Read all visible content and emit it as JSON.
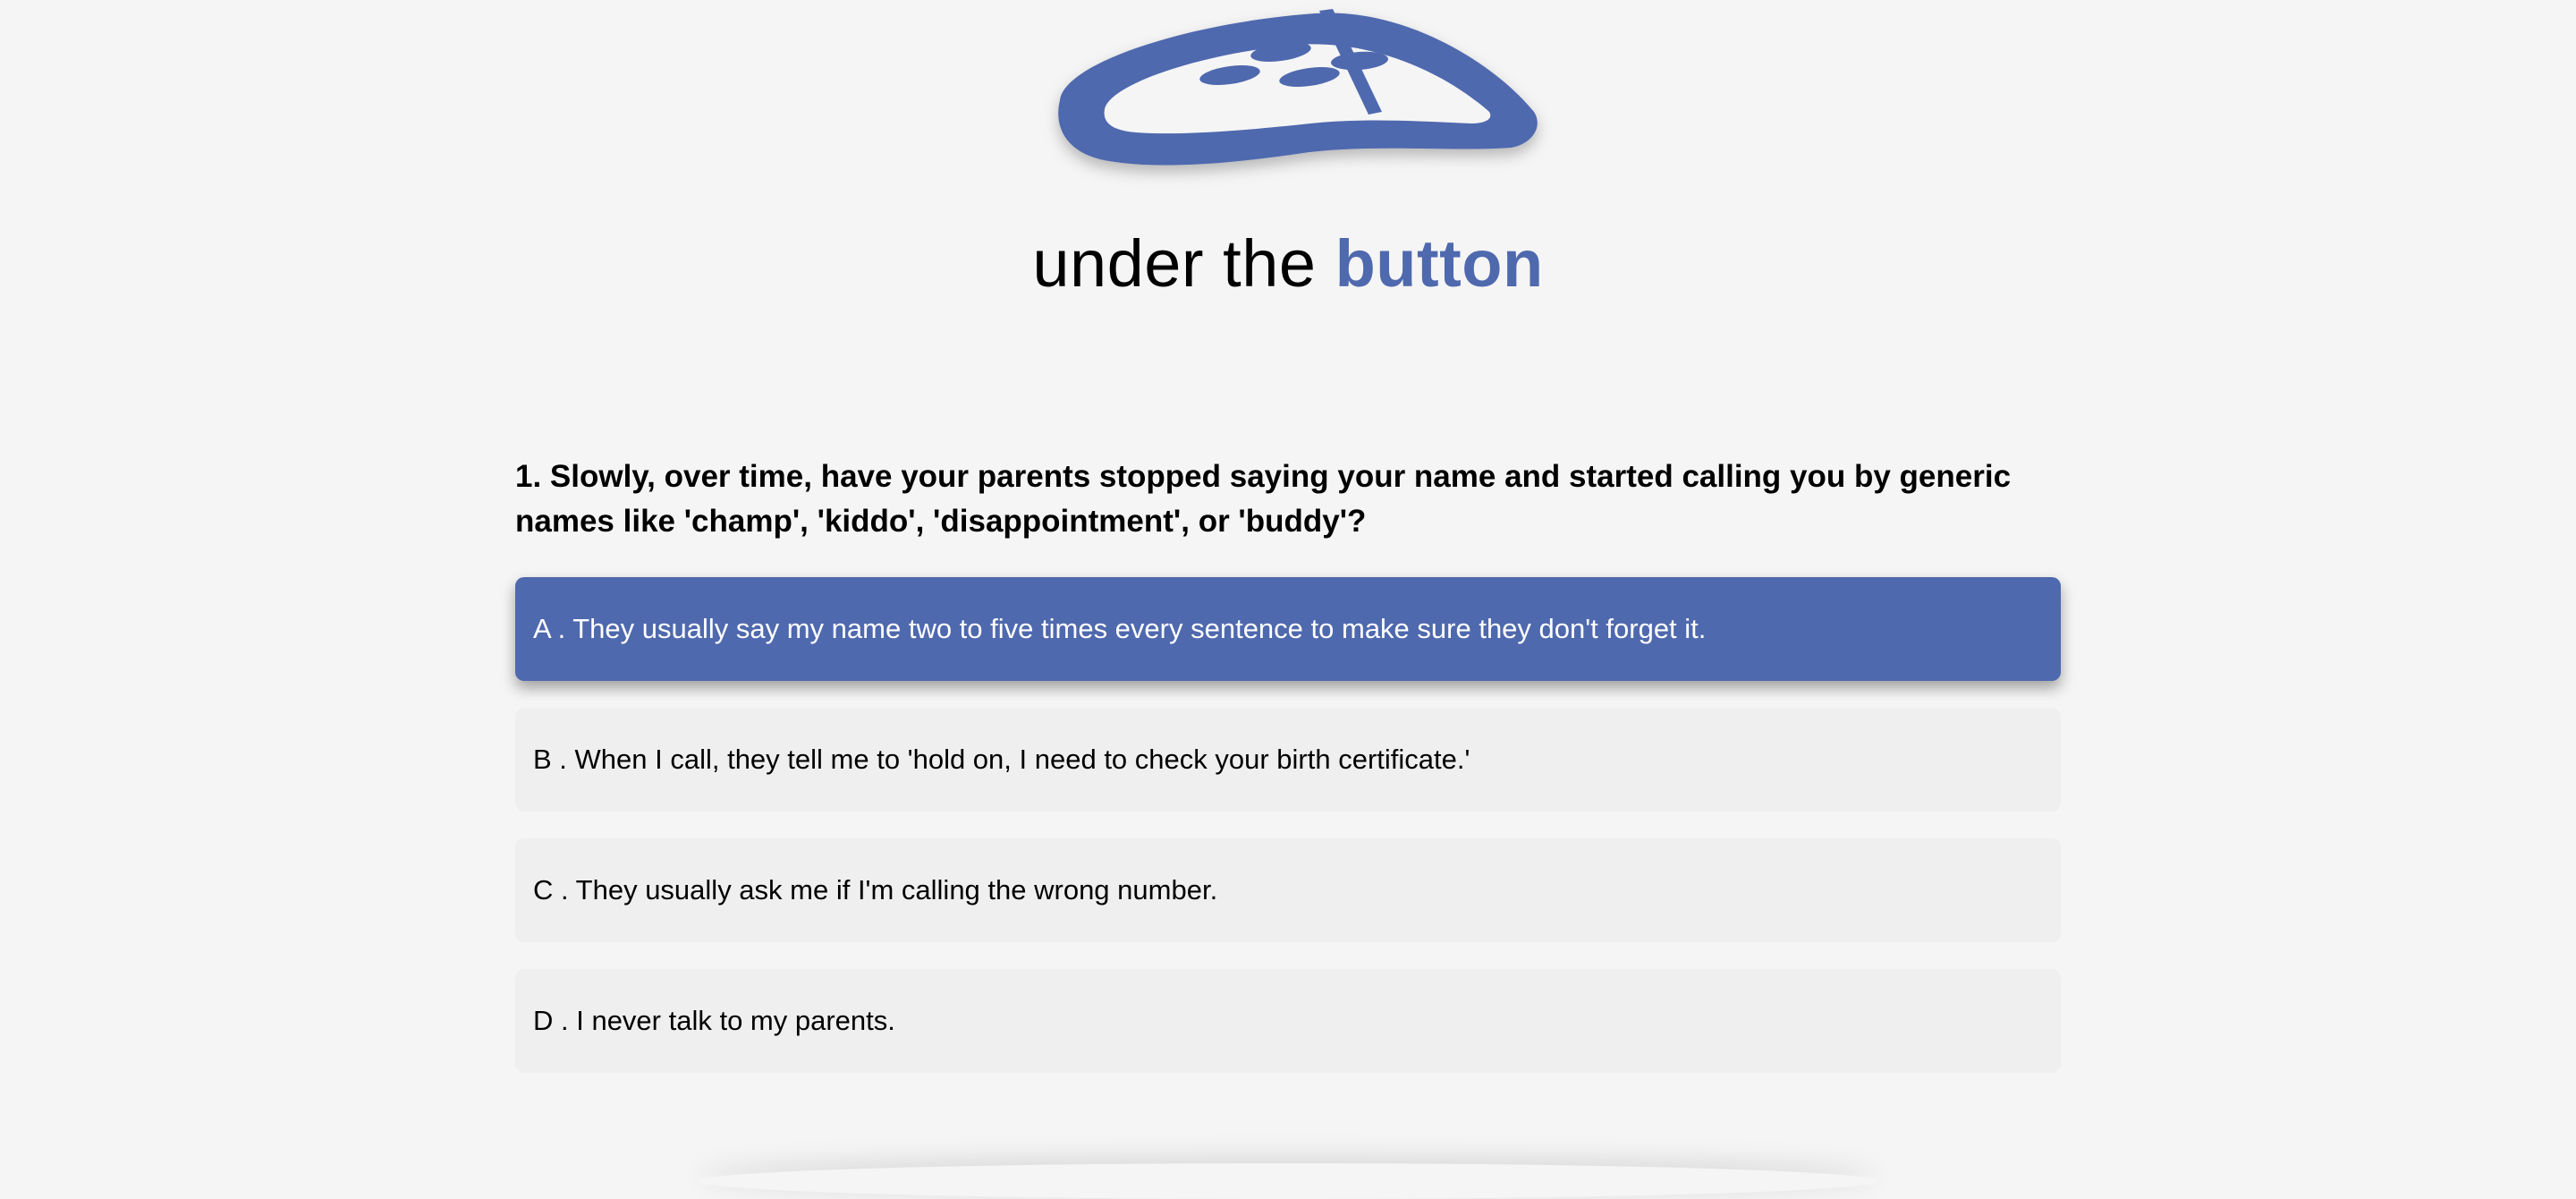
{
  "brand": {
    "prefix": "under the ",
    "accent": "button",
    "accent_color": "#4f69ae"
  },
  "logo": {
    "icon": "game-controller-logo-icon",
    "color": "#4f69ae"
  },
  "quiz": {
    "question": "1. Slowly, over time, have your parents stopped saying your name and started calling you by generic names like 'champ', 'kiddo', 'disappointment', or 'buddy'?",
    "selected": "A",
    "options": [
      {
        "letter": "A",
        "text": "A . They usually say my name two to five times every sentence to make sure they don't forget it."
      },
      {
        "letter": "B",
        "text": "B . When I call, they tell me to 'hold on, I need to check your birth certificate.'"
      },
      {
        "letter": "C",
        "text": "C . They usually ask me if I'm calling the wrong number."
      },
      {
        "letter": "D",
        "text": "D . I never talk to my parents."
      }
    ]
  }
}
